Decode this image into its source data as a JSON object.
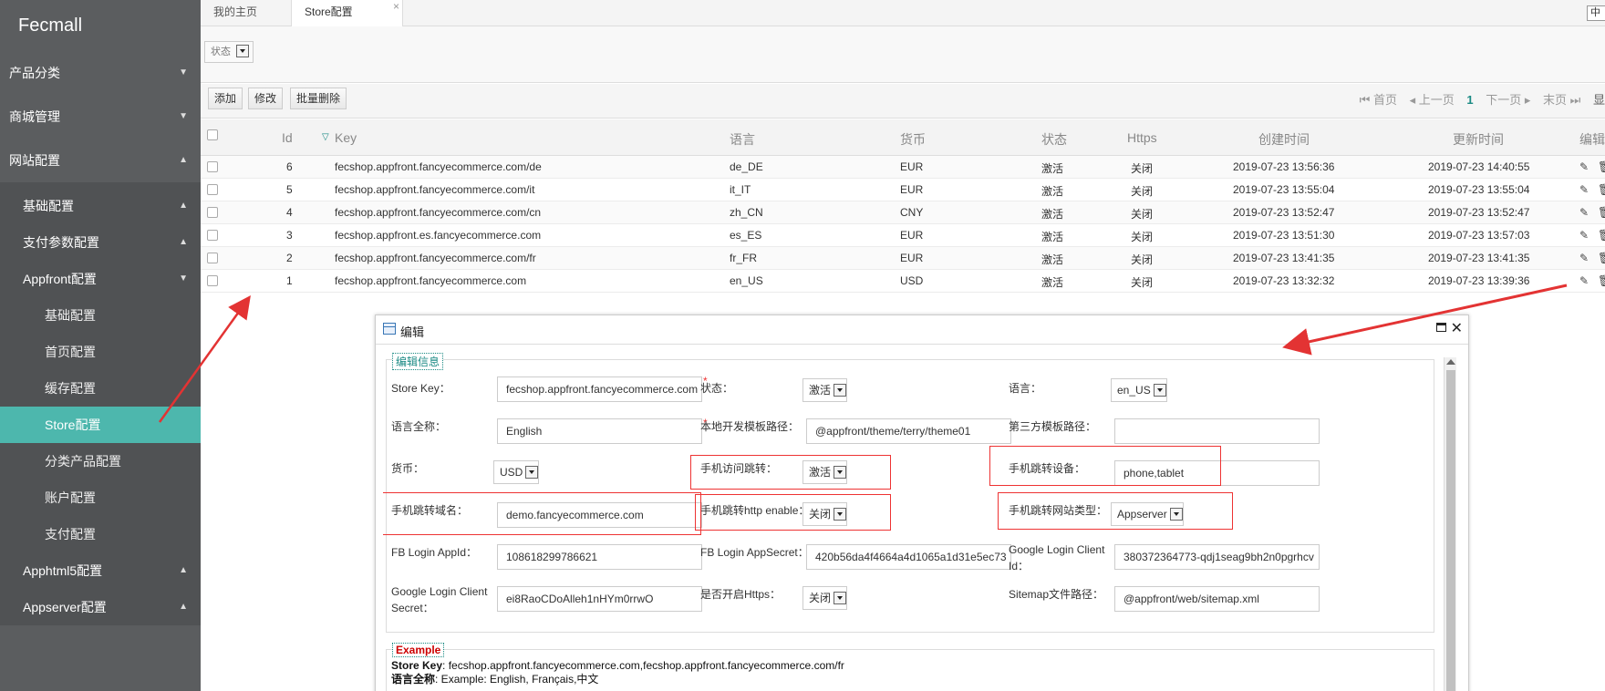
{
  "app": {
    "logo": "Fecmall"
  },
  "sidebar": {
    "top_items": [
      {
        "label": "产品分类"
      },
      {
        "label": "商城管理"
      },
      {
        "label": "网站配置"
      }
    ],
    "sub_items": [
      {
        "label": "基础配置"
      },
      {
        "label": "支付参数配置"
      },
      {
        "label": "Appfront配置"
      }
    ],
    "appfront_items": [
      {
        "label": "基础配置"
      },
      {
        "label": "首页配置"
      },
      {
        "label": "缓存配置"
      },
      {
        "label": "Store配置"
      },
      {
        "label": "分类产品配置"
      },
      {
        "label": "账户配置"
      },
      {
        "label": "支付配置"
      }
    ],
    "tail_items": [
      {
        "label": "Apphtml5配置"
      },
      {
        "label": "Appserver配置"
      }
    ]
  },
  "tabs": [
    {
      "label": "我的主页"
    },
    {
      "label": "Store配置",
      "close": "×"
    }
  ],
  "lang_box": "中",
  "filter": {
    "status_label": "状态"
  },
  "toolbar": {
    "add": "添加",
    "edit": "修改",
    "batch_delete": "批量删除"
  },
  "pager": {
    "first": "首页",
    "prev": "上一页",
    "current": "1",
    "next": "下一页",
    "last": "末页",
    "extra": "显"
  },
  "table": {
    "headers": {
      "id": "Id",
      "key": "Key",
      "lang": "语言",
      "currency": "货币",
      "status": "状态",
      "https": "Https",
      "created": "创建时间",
      "updated": "更新时间",
      "edit": "编辑"
    },
    "rows": [
      {
        "id": "6",
        "key": "fecshop.appfront.fancyecommerce.com/de",
        "lang": "de_DE",
        "currency": "EUR",
        "status": "激活",
        "https": "关闭",
        "created": "2019-07-23 13:56:36",
        "updated": "2019-07-23 14:40:55"
      },
      {
        "id": "5",
        "key": "fecshop.appfront.fancyecommerce.com/it",
        "lang": "it_IT",
        "currency": "EUR",
        "status": "激活",
        "https": "关闭",
        "created": "2019-07-23 13:55:04",
        "updated": "2019-07-23 13:55:04"
      },
      {
        "id": "4",
        "key": "fecshop.appfront.fancyecommerce.com/cn",
        "lang": "zh_CN",
        "currency": "CNY",
        "status": "激活",
        "https": "关闭",
        "created": "2019-07-23 13:52:47",
        "updated": "2019-07-23 13:52:47"
      },
      {
        "id": "3",
        "key": "fecshop.appfront.es.fancyecommerce.com",
        "lang": "es_ES",
        "currency": "EUR",
        "status": "激活",
        "https": "关闭",
        "created": "2019-07-23 13:51:30",
        "updated": "2019-07-23 13:57:03"
      },
      {
        "id": "2",
        "key": "fecshop.appfront.fancyecommerce.com/fr",
        "lang": "fr_FR",
        "currency": "EUR",
        "status": "激活",
        "https": "关闭",
        "created": "2019-07-23 13:41:35",
        "updated": "2019-07-23 13:41:35"
      },
      {
        "id": "1",
        "key": "fecshop.appfront.fancyecommerce.com",
        "lang": "en_US",
        "currency": "USD",
        "status": "激活",
        "https": "关闭",
        "created": "2019-07-23 13:32:32",
        "updated": "2019-07-23 13:39:36"
      }
    ]
  },
  "modal": {
    "title": "编辑",
    "legend": "编辑信息",
    "fields": {
      "store_key_label": "Store Key：",
      "store_key_value": "fecshop.appfront.fancyecommerce.com",
      "status_label": "状态：",
      "status_value": "激活",
      "lang_label": "语言：",
      "lang_value": "en_US",
      "lang_name_label": "语言全称：",
      "lang_name_value": "English",
      "local_theme_label": "本地开发模板路径：",
      "local_theme_value": "@appfront/theme/terry/theme01",
      "third_theme_label": "第三方模板路径：",
      "third_theme_value": "",
      "currency_label": "货币：",
      "currency_value": "USD",
      "mobile_redirect_label": "手机访问跳转：",
      "mobile_redirect_value": "激活",
      "mobile_device_label": "手机跳转设备：",
      "mobile_device_value": "phone,tablet",
      "mobile_domain_label": "手机跳转域名：",
      "mobile_domain_value": "demo.fancyecommerce.com",
      "mobile_https_label": "手机跳转http enable：",
      "mobile_https_value": "关闭",
      "mobile_type_label": "手机跳转网站类型：",
      "mobile_type_value": "Appserver",
      "fb_appid_label": "FB Login AppId：",
      "fb_appid_value": "108618299786621",
      "fb_secret_label": "FB Login AppSecret：",
      "fb_secret_value": "420b56da4f4664a4d1065a1d31e5ec73",
      "google_id_label_1": "Google Login Client",
      "google_id_label_2": "Id：",
      "google_id_value": "380372364773-qdj1seag9bh2n0pgrhcv",
      "google_secret_label_1": "Google Login Client",
      "google_secret_label_2": "Secret：",
      "google_secret_value": "ei8RaoCDoAlleh1nHYm0rrwO",
      "https_label": "是否开启Https：",
      "https_value": "关闭",
      "sitemap_label": "Sitemap文件路径：",
      "sitemap_value": "@appfront/web/sitemap.xml"
    },
    "example": {
      "legend": "Example",
      "line1_key": "Store Key",
      "line1_val": ": fecshop.appfront.fancyecommerce.com,fecshop.appfront.fancyecommerce.com/fr",
      "line2_key": "语言全称",
      "line2_val": ": Example: English, Français,中文"
    }
  },
  "colors": {
    "sidebar_bg": "#5b5d5f",
    "active_item": "#4db7ad",
    "accent": "#1b8a84",
    "annotation_red": "#e33333"
  }
}
